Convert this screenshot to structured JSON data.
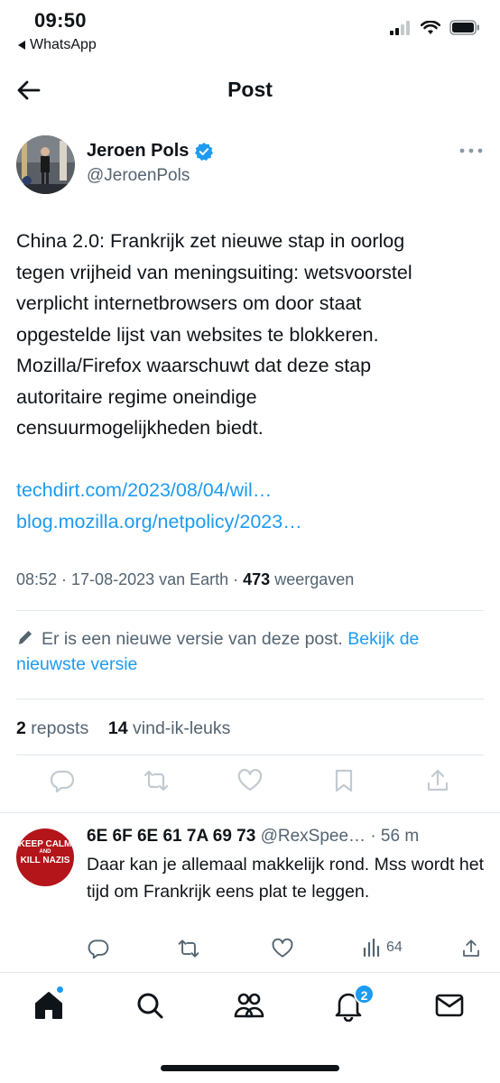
{
  "status_bar": {
    "time": "09:50",
    "back_app": "WhatsApp"
  },
  "header": {
    "title": "Post"
  },
  "post": {
    "author_name": "Jeroen Pols",
    "author_handle": "@JeroenPols",
    "text": "China 2.0: Frankrijk zet nieuwe stap in oorlog\ntegen vrijheid van meningsuiting: wetsvoorstel\nverplicht internetbrowsers om door staat\nopgestelde lijst van websites te blokkeren.\nMozilla/Firefox waarschuwt dat deze stap\nautoritaire regime oneindige\ncensuurmogelijkheden biedt.",
    "links": [
      "techdirt.com/2023/08/04/wil…",
      "blog.mozilla.org/netpolicy/2023…"
    ],
    "meta_time": "08:52 · 17-08-2023 van Earth · ",
    "views_count": "473",
    "views_label": " weergaven",
    "edit_notice": "Er is een nieuwe versie van deze post. ",
    "edit_link": "Bekijk de nieuwste versie",
    "reposts_count": "2",
    "reposts_label": " reposts",
    "likes_count": "14",
    "likes_label": " vind-ik-leuks"
  },
  "reply": {
    "avatar_text_1": "KEEP CALM",
    "avatar_text_2": "AND",
    "avatar_text_3": "KILL NAZIS",
    "name": "6E 6F 6E 61 7A 69 73",
    "handle": " @RexSpee…",
    "time": " · 56 m",
    "text": "Daar kan je allemaal makkelijk rond. Mss wordt het tijd om Frankrijk eens plat te leggen.",
    "views": "64"
  },
  "tabbar": {
    "notifications_badge": "2"
  },
  "colors": {
    "accent": "#1d9bf0",
    "secondary_text": "#536471",
    "primary_text": "#0f1419"
  }
}
